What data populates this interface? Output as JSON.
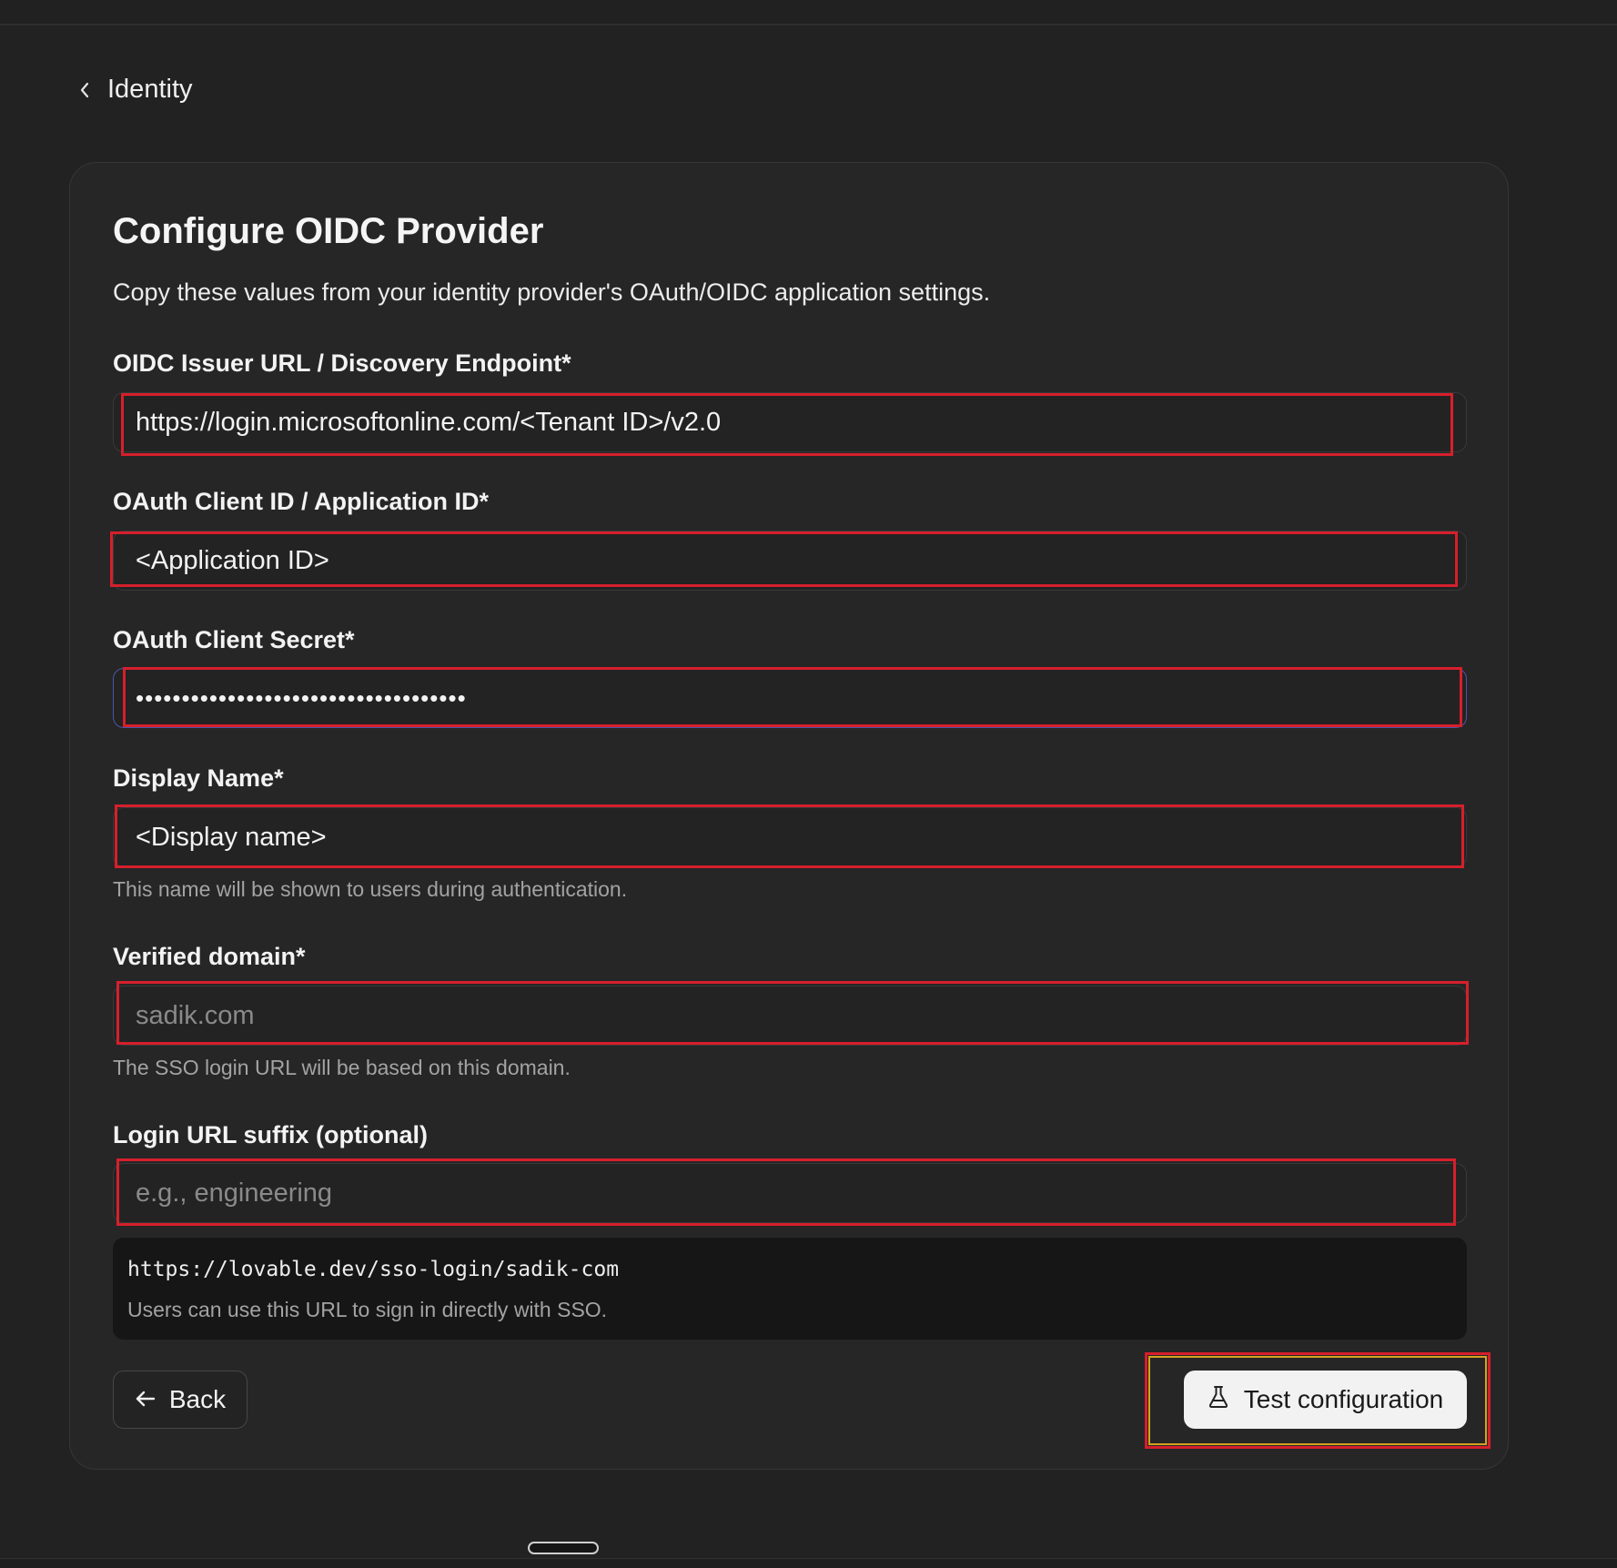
{
  "breadcrumb": {
    "back_label": "Identity",
    "icon": "chevron-left-icon"
  },
  "page": {
    "title": "Configure OIDC Provider",
    "subtitle": "Copy these values from your identity provider's OAuth/OIDC application settings."
  },
  "fields": {
    "issuer": {
      "label": "OIDC Issuer URL / Discovery Endpoint*",
      "value": "https://login.microsoftonline.com/<Tenant ID>/v2.0"
    },
    "client_id": {
      "label": "OAuth Client ID / Application ID*",
      "value": "<Application ID>"
    },
    "client_secret": {
      "label": "OAuth Client Secret*",
      "value": "••••••••••••••••••••••••••••••••••••"
    },
    "display_name": {
      "label": "Display Name*",
      "value": "<Display name>",
      "helper": "This name will be shown to users during authentication."
    },
    "verified_domain": {
      "label": "Verified domain*",
      "placeholder": "sadik.com",
      "helper": "The SSO login URL will be based on this domain."
    },
    "login_suffix": {
      "label": "Login URL suffix (optional)",
      "placeholder": "e.g., engineering"
    }
  },
  "sso_url": {
    "url": "https://lovable.dev/sso-login/sadik-com",
    "note": "Users can use this URL to sign in directly with SSO."
  },
  "actions": {
    "back_label": "Back",
    "back_icon": "arrow-left-icon",
    "test_label": "Test configuration",
    "test_icon": "flask-icon"
  },
  "colors": {
    "background": "#222222",
    "card": "#262626",
    "highlight": "#d61f2c",
    "primary_button": "#f2f2f2"
  }
}
